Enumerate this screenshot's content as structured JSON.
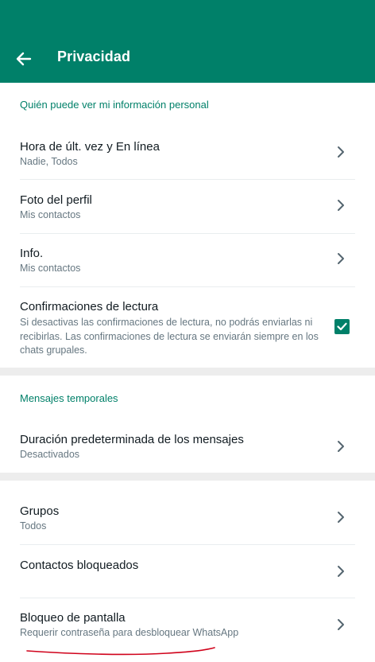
{
  "header": {
    "title": "Privacidad"
  },
  "personal": {
    "section_title": "Quién puede ver mi información personal",
    "last_seen": {
      "label": "Hora de últ. vez y En línea",
      "value": "Nadie, Todos"
    },
    "profile_photo": {
      "label": "Foto del perfil",
      "value": "Mis contactos"
    },
    "about": {
      "label": "Info.",
      "value": "Mis contactos"
    },
    "read_receipts": {
      "label": "Confirmaciones de lectura",
      "desc_line1": "Si desactivas las confirmaciones de lectura, no podrás enviarlas ni",
      "desc_line2": "recibirlas. Las confirmaciones de lectura se enviarán siempre en los",
      "desc_line3": "chats grupales.",
      "checked": true
    }
  },
  "temporary": {
    "section_title": "Mensajes temporales",
    "default_duration": {
      "label": "Duración predeterminada de los mensajes",
      "value": "Desactivados"
    }
  },
  "other": {
    "groups": {
      "label": "Grupos",
      "value": "Todos"
    },
    "blocked": {
      "label": "Contactos bloqueados"
    },
    "screen_lock": {
      "label": "Bloqueo de pantalla",
      "value": "Requerir contraseña para desbloquear WhatsApp"
    }
  },
  "colors": {
    "accent": "#008069",
    "annotation": "#d0021b"
  }
}
